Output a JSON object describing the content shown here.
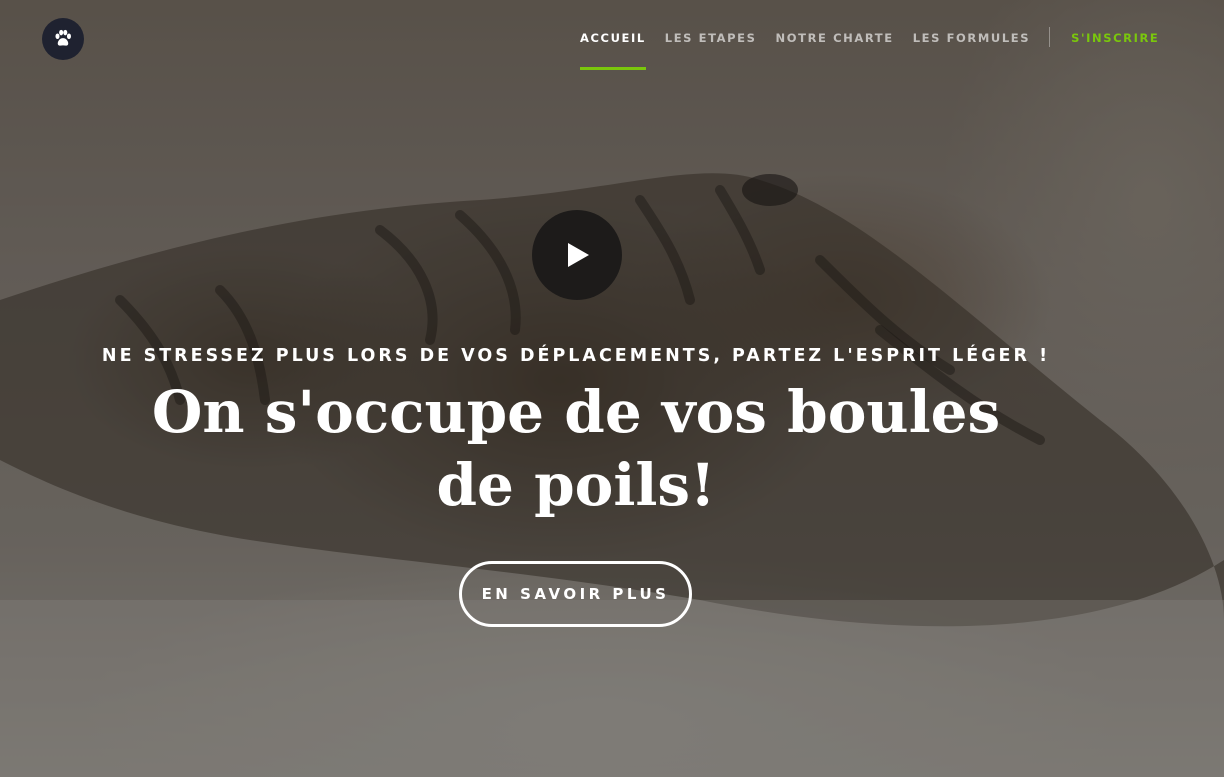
{
  "nav": {
    "items": [
      {
        "label": "ACCUEIL",
        "active": true
      },
      {
        "label": "LES ETAPES",
        "active": false
      },
      {
        "label": "NOTRE CHARTE",
        "active": false
      },
      {
        "label": "LES FORMULES",
        "active": false
      }
    ],
    "cta_label": "S'INSCRIRE"
  },
  "logo": {
    "icon": "paw-icon"
  },
  "hero": {
    "background_image": "tabby cat lying on fluffy white rug",
    "play_icon": "play-icon",
    "tagline": "NE STRESSEZ PLUS LORS DE VOS DÉPLACEMENTS, PARTEZ L'ESPRIT LÉGER !",
    "headline_line1": "On s'occupe de vos boules",
    "headline_line2": "de poils!",
    "cta_label": "EN SAVOIR PLUS"
  },
  "colors": {
    "accent": "#7ac70c",
    "logo_bg": "#1f2230",
    "play_bg": "#1d1b1a"
  }
}
